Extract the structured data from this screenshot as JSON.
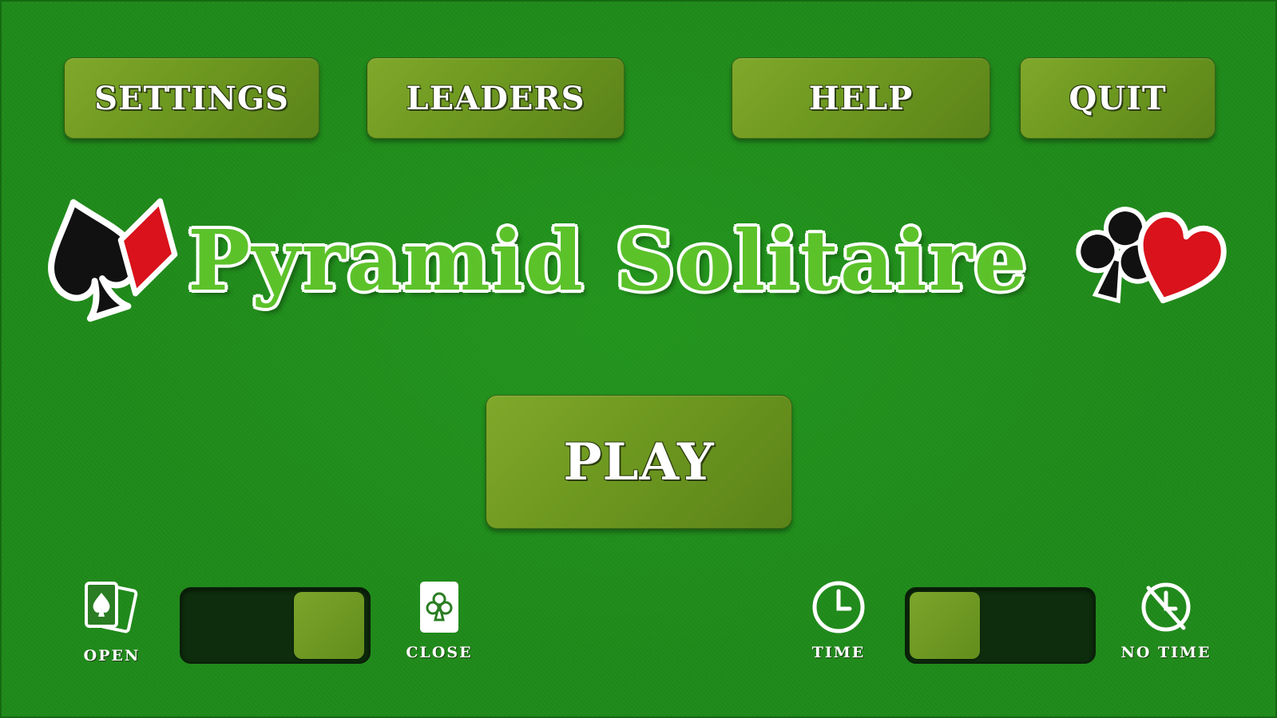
{
  "menu": {
    "settings_label": "SETTINGS",
    "leaders_label": "LEADERS",
    "help_label": "HELP",
    "quit_label": "QUIT"
  },
  "logo": {
    "title": "Pyramid Solitaire"
  },
  "play_label": "PLAY",
  "deck_mode": {
    "open_label": "OPEN",
    "close_label": "CLOSE",
    "selected": "CLOSE"
  },
  "timer_mode": {
    "time_label": "TIME",
    "no_time_label": "NO TIME",
    "selected": "TIME"
  },
  "colors": {
    "felt": "#1f8a1a",
    "button": "#6f9a20",
    "title_green": "#5cc22a",
    "suit_red": "#d9121b",
    "suit_black": "#111111"
  }
}
